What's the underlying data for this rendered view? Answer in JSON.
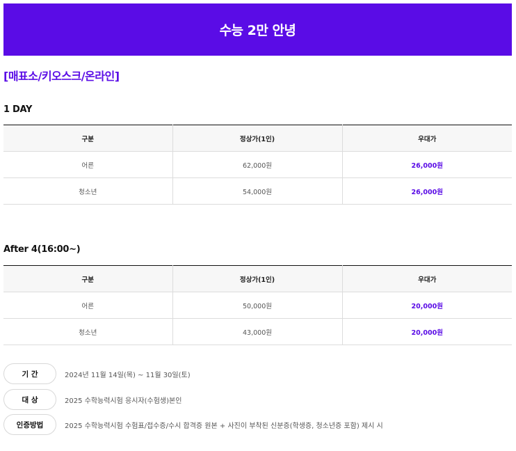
{
  "banner": {
    "title": "수능 2만 안녕"
  },
  "channel_label": "[매표소/키오스크/온라인]",
  "sections": [
    {
      "title": "1 DAY",
      "headers": [
        "구분",
        "정상가(1인)",
        "우대가"
      ],
      "rows": [
        {
          "category": "어른",
          "regular": "62,000원",
          "discount": "26,000원"
        },
        {
          "category": "청소년",
          "regular": "54,000원",
          "discount": "26,000원"
        }
      ]
    },
    {
      "title": "After 4(16:00~)",
      "headers": [
        "구분",
        "정상가(1인)",
        "우대가"
      ],
      "rows": [
        {
          "category": "어른",
          "regular": "50,000원",
          "discount": "20,000원"
        },
        {
          "category": "청소년",
          "regular": "43,000원",
          "discount": "20,000원"
        }
      ]
    }
  ],
  "info": [
    {
      "label": "기 간",
      "text": "2024년 11월 14일(목) ~ 11월 30일(토)"
    },
    {
      "label": "대 상",
      "text": "2025 수학능력시험 응시자(수험생)본인"
    },
    {
      "label": "인증방법",
      "text": "2025 수학능력시험 수험표/접수증/수시 합격증 원본 + 사진이 부착된 신분증(학생증, 청소년증 포함) 제시 시"
    }
  ],
  "colors": {
    "accent": "#5a0ce6"
  }
}
